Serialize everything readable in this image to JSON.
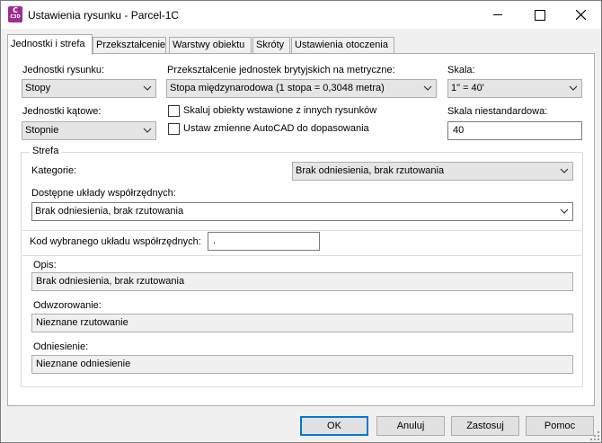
{
  "window": {
    "title": "Ustawienia rysunku - Parcel-1C",
    "icon_line1": "C",
    "icon_line2": "C3D"
  },
  "tabs": [
    {
      "label": "Jednostki i strefa",
      "active": true
    },
    {
      "label": "Przekształcenie",
      "active": false
    },
    {
      "label": "Warstwy obiektu",
      "active": false
    },
    {
      "label": "Skróty",
      "active": false
    },
    {
      "label": "Ustawienia otoczenia",
      "active": false
    }
  ],
  "units": {
    "drawing_units_label": "Jednostki rysunku:",
    "drawing_units_value": "Stopy",
    "conversion_label": "Przekształcenie jednostek brytyjskich na metryczne:",
    "conversion_value": "Stopa międzynarodowa (1 stopa = 0,3048 metra)",
    "scale_label": "Skala:",
    "scale_value": "1\" = 40'",
    "angular_units_label": "Jednostki kątowe:",
    "angular_units_value": "Stopnie",
    "scale_inserted_label": "Skaluj obiekty wstawione z innych rysunków",
    "scale_inserted_checked": false,
    "set_autocad_vars_label": "Ustaw zmienne AutoCAD do dopasowania",
    "set_autocad_vars_checked": false,
    "custom_scale_label": "Skala niestandardowa:",
    "custom_scale_value": "40"
  },
  "zone": {
    "group_title": "Strefa",
    "category_label": "Kategorie:",
    "category_value": "Brak odniesienia, brak rzutowania",
    "available_cs_label": "Dostępne układy współrzędnych:",
    "available_cs_value": "Brak odniesienia, brak rzutowania",
    "selected_code_label": "Kod wybranego układu współrzędnych:",
    "selected_code_value": ".",
    "description_label": "Opis:",
    "description_value": "Brak odniesienia, brak rzutowania",
    "projection_label": "Odwzorowanie:",
    "projection_value": "Nieznane rzutowanie",
    "datum_label": "Odniesienie:",
    "datum_value": "Nieznane odniesienie"
  },
  "buttons": {
    "ok": "OK",
    "cancel": "Anuluj",
    "apply": "Zastosuj",
    "help": "Pomoc"
  },
  "colors": {
    "accent": "#0078d7",
    "app_icon": "#9b2d91"
  }
}
